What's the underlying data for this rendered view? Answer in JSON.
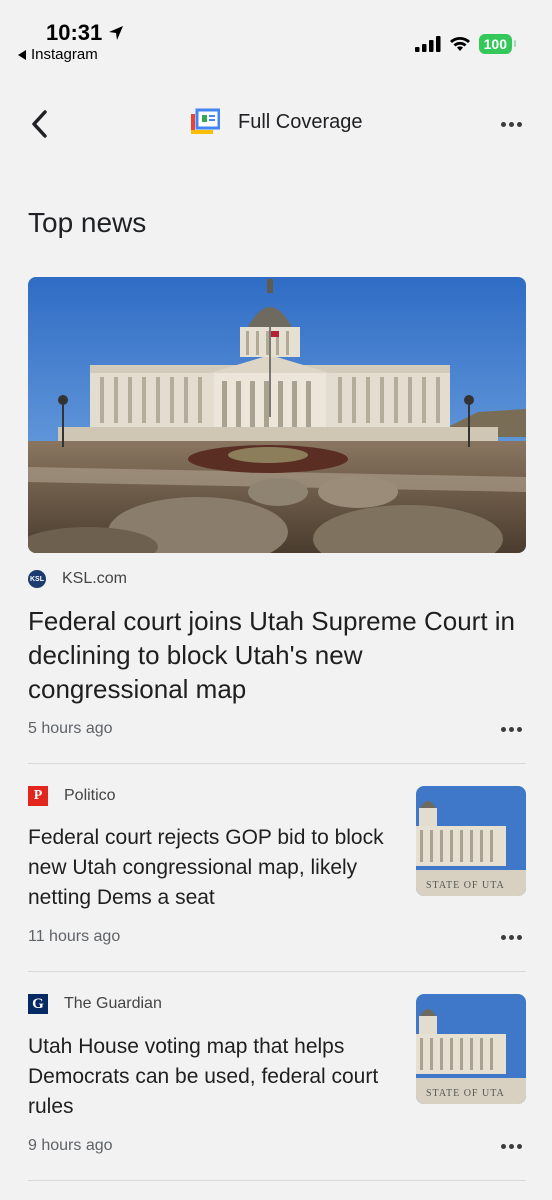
{
  "status_bar": {
    "time": "10:31",
    "back_app": "Instagram",
    "battery": "100"
  },
  "header": {
    "title": "Full Coverage"
  },
  "section": {
    "title": "Top news"
  },
  "hero": {
    "source": "KSL.com",
    "source_logo_text": "KSL",
    "headline": "Federal court joins Utah Supreme Court in declining to block Utah's new congressional map",
    "time": "5 hours ago"
  },
  "stories": [
    {
      "source": "Politico",
      "logo_text": "P",
      "headline": "Federal court rejects GOP bid to block new Utah congressional map, likely netting Dems a seat",
      "time": "11 hours ago",
      "thumb_text": "STATE OF UTA"
    },
    {
      "source": "The Guardian",
      "logo_text": "G",
      "headline": "Utah House voting map that helps Democrats can be used, federal court rules",
      "time": "9 hours ago",
      "thumb_text": "STATE OF UTA"
    }
  ],
  "colors": {
    "background": "#f2f2f2",
    "battery": "#34c759",
    "politico": "#e2261d",
    "guardian": "#052962",
    "sky": "#3f78c8"
  }
}
